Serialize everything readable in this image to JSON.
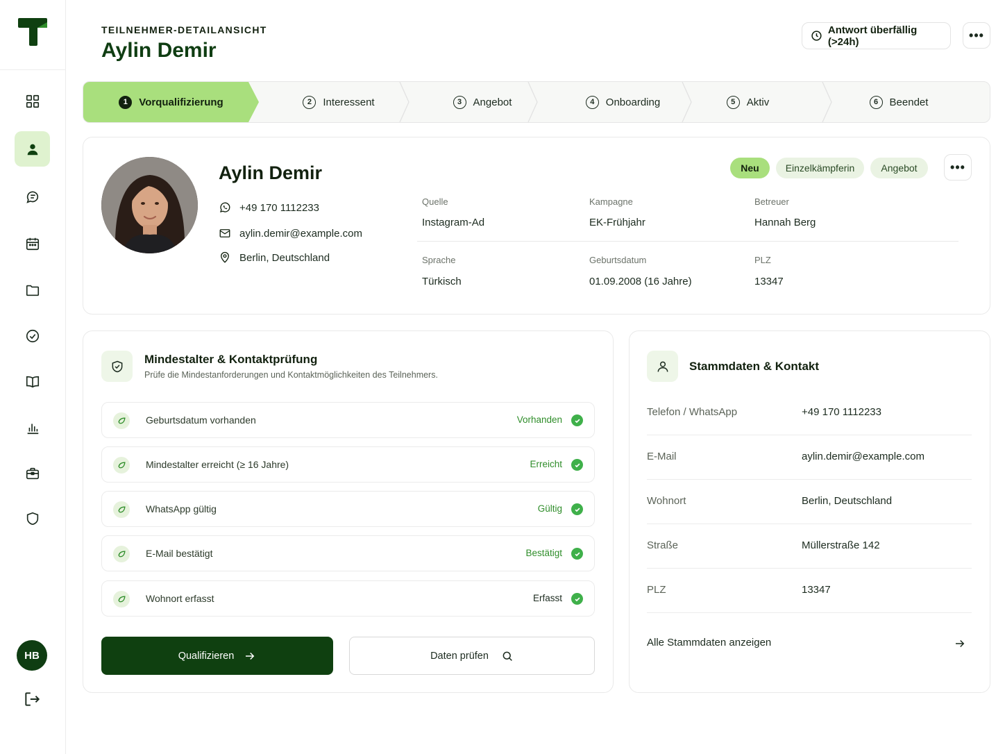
{
  "header": {
    "eyebrow": "TEILNEHMER-DETAILANSICHT",
    "title": "Aylin Demir",
    "overdue_label": "Antwort überfällig (>24h)"
  },
  "sidebar": {
    "items": [
      {
        "icon": "dashboard-grid-icon",
        "active": false
      },
      {
        "icon": "user-icon",
        "active": true
      },
      {
        "icon": "chat-icon",
        "active": false
      },
      {
        "icon": "calendar-icon",
        "active": false
      },
      {
        "icon": "folder-icon",
        "active": false
      },
      {
        "icon": "check-circle-icon",
        "active": false
      },
      {
        "icon": "book-icon",
        "active": false
      },
      {
        "icon": "bar-chart-icon",
        "active": false
      },
      {
        "icon": "briefcase-icon",
        "active": false
      },
      {
        "icon": "shield-icon",
        "active": false
      }
    ],
    "user_initials": "HB"
  },
  "stepper": {
    "steps": [
      {
        "num": "1",
        "label": "Vorqualifizierung",
        "active": true
      },
      {
        "num": "2",
        "label": "Interessent",
        "active": false
      },
      {
        "num": "3",
        "label": "Angebot",
        "active": false
      },
      {
        "num": "4",
        "label": "Onboarding",
        "active": false
      },
      {
        "num": "5",
        "label": "Aktiv",
        "active": false
      },
      {
        "num": "6",
        "label": "Beendet",
        "active": false
      }
    ]
  },
  "profile": {
    "name": "Aylin Demir",
    "phone": "+49 170 1112233",
    "email": "aylin.demir@example.com",
    "location": "Berlin, Deutschland",
    "tags": [
      "Neu",
      "Einzelkämpferin",
      "Angebot"
    ],
    "meta": [
      {
        "label": "Quelle",
        "value": "Instagram-Ad"
      },
      {
        "label": "Kampagne",
        "value": "EK-Frühjahr"
      },
      {
        "label": "Betreuer",
        "value": "Hannah Berg"
      },
      {
        "label": "Sprache",
        "value": "Türkisch"
      },
      {
        "label": "Geburtsdatum",
        "value": "01.09.2008 (16 Jahre)"
      },
      {
        "label": "PLZ",
        "value": "13347"
      }
    ]
  },
  "checks": {
    "title": "Mindestalter & Kontaktprüfung",
    "subtitle": "Prüfe die Mindestanforderungen und Kontaktmöglichkeiten des Teilnehmers.",
    "rows": [
      {
        "label": "Geburtsdatum vorhanden",
        "status": "Vorhanden"
      },
      {
        "label": "Mindestalter erreicht  (≥ 16 Jahre)",
        "status": "Erreicht"
      },
      {
        "label": "WhatsApp gültig",
        "status": "Gültig"
      },
      {
        "label": "E-Mail bestätigt",
        "status": "Bestätigt"
      },
      {
        "label": "Wohnort erfasst",
        "status": "Erfasst"
      }
    ],
    "primary_button": "Qualifizieren",
    "secondary_button": "Daten prüfen"
  },
  "contact": {
    "title": "Stammdaten & Kontakt",
    "rows": [
      {
        "key": "Telefon / WhatsApp",
        "value": "+49 170 1112233"
      },
      {
        "key": "E-Mail",
        "value": "aylin.demir@example.com"
      },
      {
        "key": "Wohnort",
        "value": "Berlin, Deutschland"
      },
      {
        "key": "Straße",
        "value": "Müllerstraße 142"
      },
      {
        "key": "PLZ",
        "value": "13347"
      }
    ],
    "all_link": "Alle Stammdaten anzeigen"
  },
  "colors": {
    "brand_dark": "#0f4010",
    "accent_green": "#a9df7d",
    "status_green": "#3fb04a"
  }
}
